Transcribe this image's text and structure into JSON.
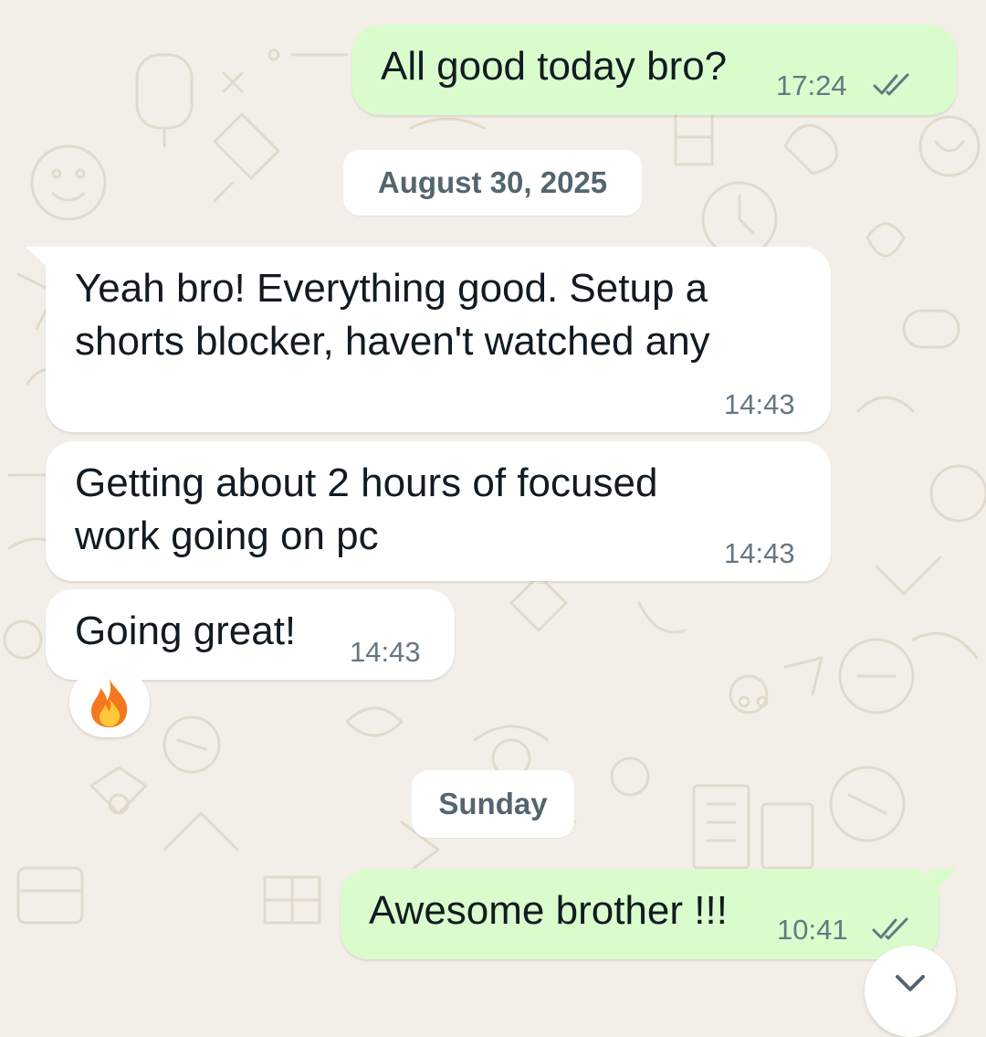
{
  "chat": {
    "messages": [
      {
        "text": "All good today bro?",
        "time": "17:24",
        "status": "read"
      },
      {
        "text": "Yeah bro! Everything good. Setup a",
        "text2": "shorts blocker, haven't watched any",
        "time": "14:43"
      },
      {
        "text": "Getting about 2 hours of focused",
        "text2": "work going on pc",
        "time": "14:43"
      },
      {
        "text": "Going great!",
        "time": "14:43",
        "reaction": "🔥"
      },
      {
        "text": "Awesome brother !!!",
        "time": "10:41",
        "status": "read"
      }
    ],
    "date_separators": [
      "August 30, 2025",
      "Sunday"
    ]
  },
  "colors": {
    "outgoing_bubble": "#dafccd",
    "incoming_bubble": "#ffffff",
    "read_ticks": "#667781",
    "wallpaper": "#f3efe8"
  },
  "icons": {
    "read_receipt": "double-check-icon",
    "scroll_down": "chevron-down-icon"
  }
}
